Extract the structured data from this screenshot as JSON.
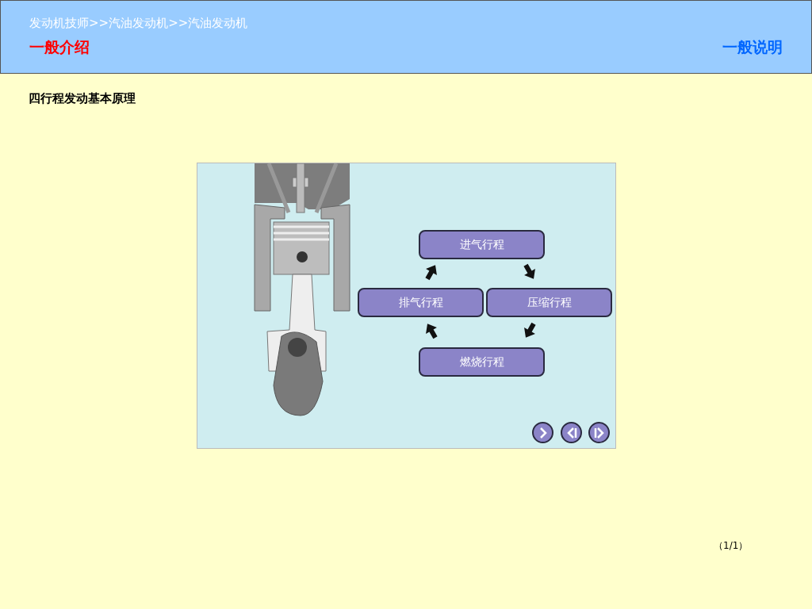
{
  "header": {
    "breadcrumb": "发动机技师>>汽油发动机>>汽油发动机",
    "title": "一般介绍",
    "link": "一般说明"
  },
  "heading": "四行程发动基本原理",
  "diagram": {
    "strokes": [
      {
        "label": "进气行程",
        "kind": "top"
      },
      {
        "label": "排气行程",
        "kind": "left"
      },
      {
        "label": "压缩行程",
        "kind": "right"
      },
      {
        "label": "燃烧行程",
        "kind": "bottom"
      }
    ]
  },
  "page_indicator": "（1/1）"
}
